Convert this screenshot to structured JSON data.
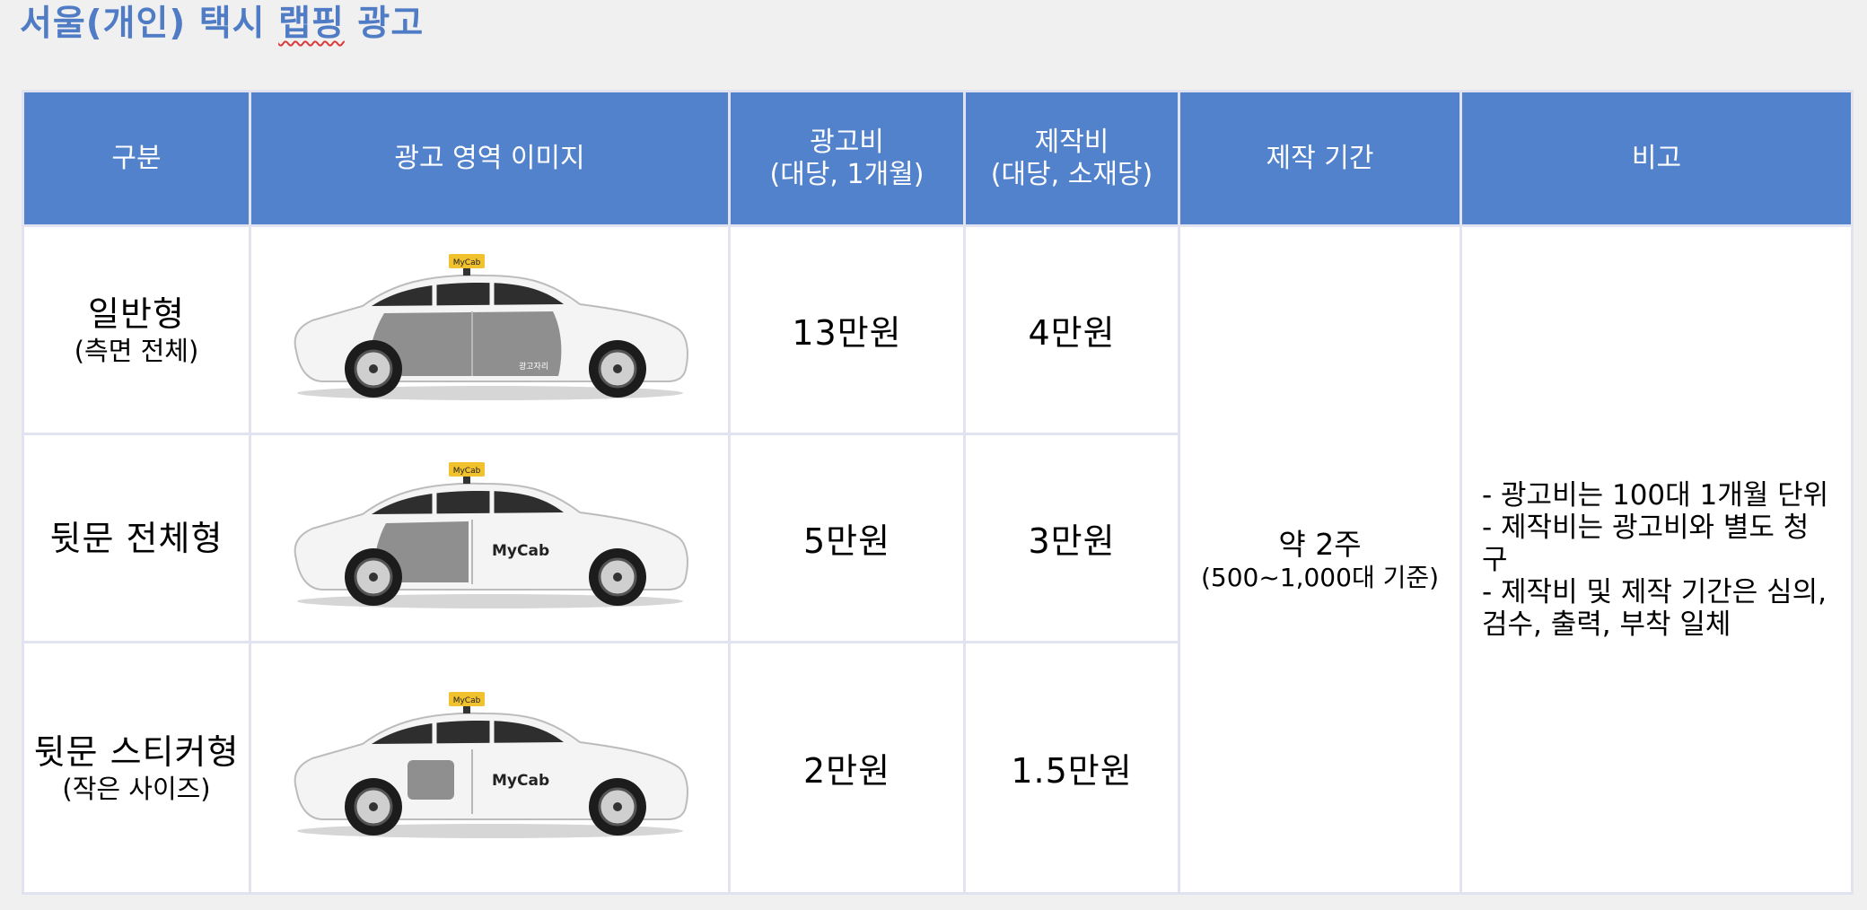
{
  "title": {
    "prefix": "서울(개인) 택시 ",
    "underlined": "랩핑",
    "suffix": " 광고"
  },
  "table": {
    "headers": {
      "category": "구분",
      "image": "광고 영역 이미지",
      "ad_fee_line1": "광고비",
      "ad_fee_line2": "(대당, 1개월)",
      "production_fee_line1": "제작비",
      "production_fee_line2": "(대당, 소재당)",
      "period": "제작 기간",
      "remarks": "비고"
    },
    "rows": [
      {
        "category_main": "일반형",
        "category_sub": "(측면 전체)",
        "ad_fee": "13만원",
        "production_fee": "4만원",
        "area": "side-full"
      },
      {
        "category_main": "뒷문 전체형",
        "category_sub": "",
        "ad_fee": "5만원",
        "production_fee": "3만원",
        "area": "rear-door-full"
      },
      {
        "category_main": "뒷문 스티커형",
        "category_sub": "(작은 사이즈)",
        "ad_fee": "2만원",
        "production_fee": "1.5만원",
        "area": "rear-door-sticker"
      }
    ],
    "period_main": "약 2주",
    "period_sub": "(500~1,000대 기준)",
    "remarks": [
      "- 광고비는 100대 1개월 단위",
      "- 제작비는 광고비와 별도 청구",
      "- 제작비 및 제작 기간은 심의, 검수, 출력, 부착 일체"
    ]
  },
  "car_labels": {
    "roof_sign": "MyCab",
    "door_brand": "MyCab",
    "ad_area_tag": "광고자리"
  },
  "colors": {
    "title": "#4f7cc5",
    "header_bg": "#5282cc",
    "ad_area_gray": "#8f8f8f",
    "roof_sign": "#f2c12e"
  }
}
